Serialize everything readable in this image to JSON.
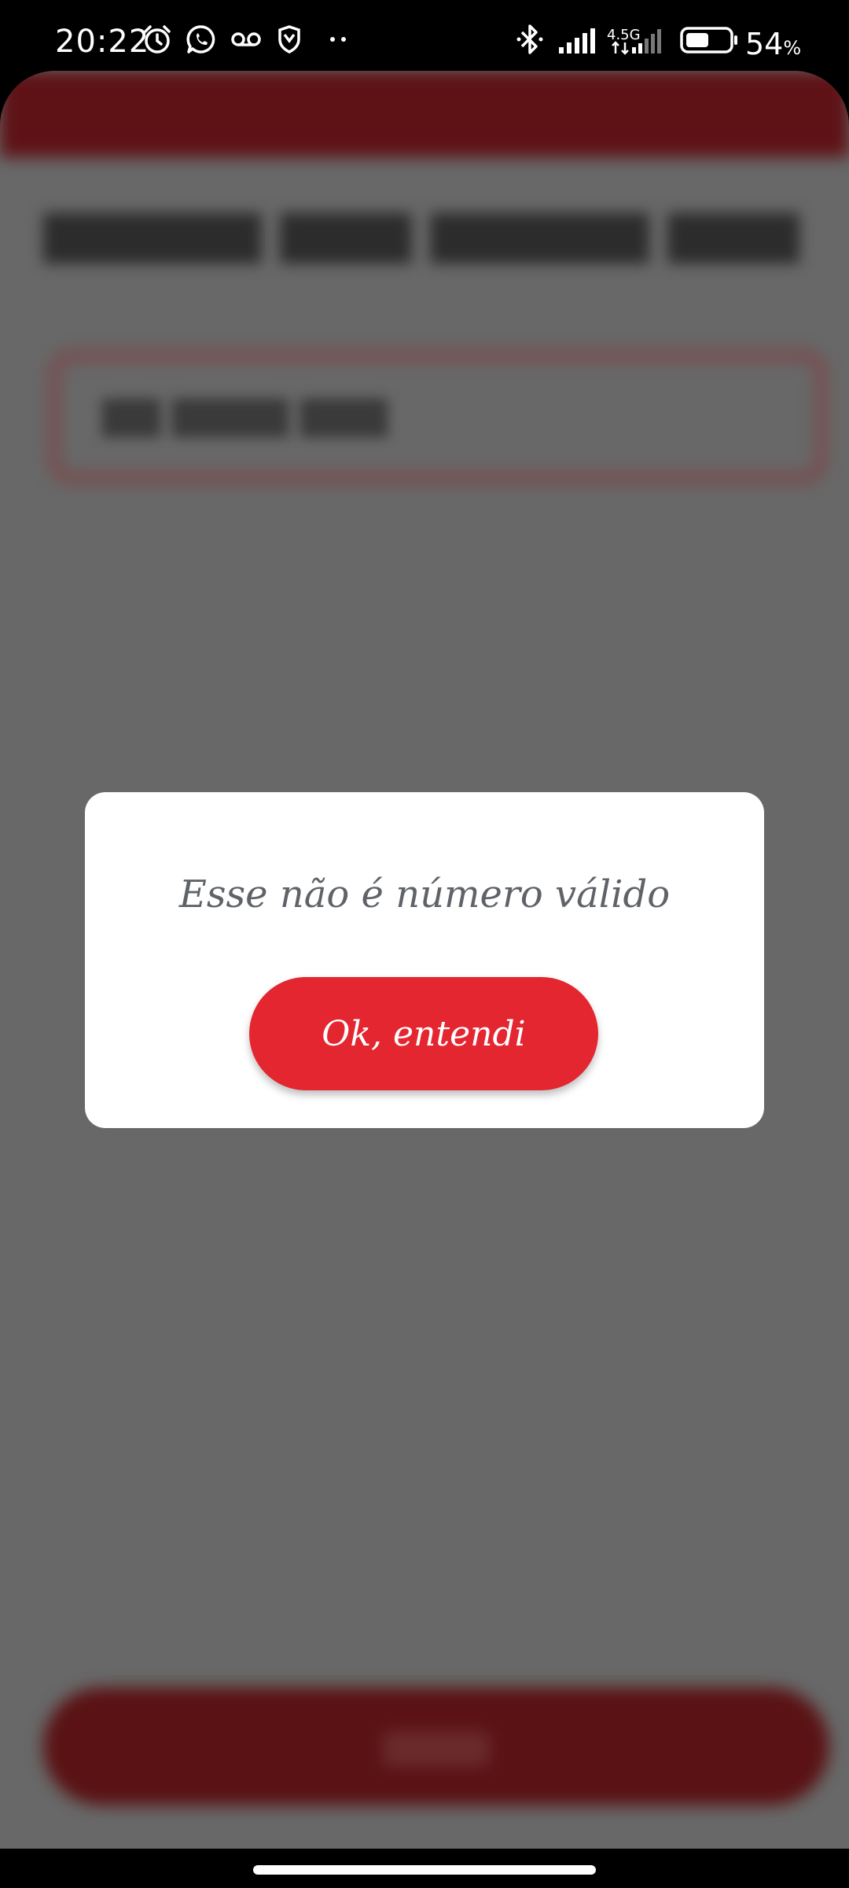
{
  "status_bar": {
    "time": "20:22",
    "network_label": "4.5G",
    "battery_percent": "54",
    "battery_unit": "%",
    "battery_level": 0.54,
    "icons": [
      "alarm-icon",
      "whatsapp-icon",
      "voicemail-icon",
      "shield-icon",
      "more-dots-icon",
      "bluetooth-icon",
      "signal-icon",
      "signal-icon-2",
      "battery-icon"
    ]
  },
  "dialog": {
    "message": "Esse não é número válido",
    "button_label": "Ok, entendi"
  },
  "colors": {
    "accent": "#e32630",
    "scrim": "#686868",
    "dialog_text": "#5f6368"
  }
}
